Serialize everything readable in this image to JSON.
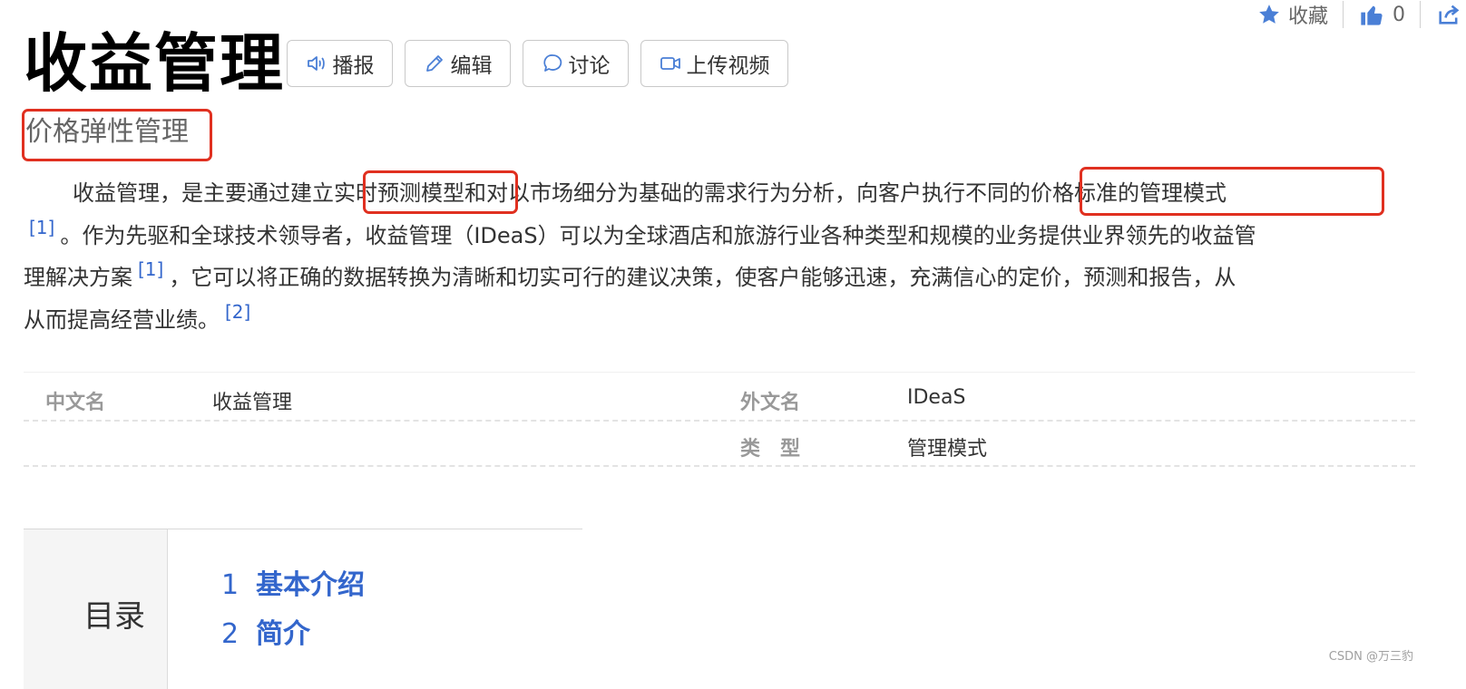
{
  "header": {
    "favorite_label": "收藏",
    "like_count": "0"
  },
  "title": "收益管理",
  "buttons": {
    "broadcast": "播报",
    "edit": "编辑",
    "discuss": "讨论",
    "upload_video": "上传视频"
  },
  "subtitle": "价格弹性管理",
  "paragraph": {
    "l1a": "收益管理，是主要通过建立",
    "l1b": "实时预测模型",
    "l1c": "和对以市场细分为基础的需求行为分析，向客户执行",
    "l1d": "不同的价格标准的管理模式",
    "ref1": "[1]",
    "l2": "。作为先驱和全球技术领导者，收益管理（IDeaS）可以为全球酒店和旅游行业各种类型和规模的业务提供业界领先的收益管",
    "l3a": "理解决方案",
    "ref2": "[1]",
    "l3b": "，它可以将正确的数据转换为清晰和切实可行的建议决策，使客户能够迅速，充满信心的定价，预测和报告，从",
    "l4": "从而提高经营业绩。",
    "ref3": "[2]"
  },
  "info": {
    "chinese_name_label": "中文名",
    "chinese_name_value": "收益管理",
    "foreign_name_label": "外文名",
    "foreign_name_value": "IDeaS",
    "type_label": "类　型",
    "type_value": "管理模式"
  },
  "toc": {
    "label": "目录",
    "items": [
      {
        "num": "1",
        "text": "基本介绍"
      },
      {
        "num": "2",
        "text": "简介"
      }
    ]
  },
  "watermark": "CSDN @万三豹",
  "colors": {
    "link": "#3366cc",
    "highlight_box": "#e03020",
    "icon_blue": "#4a7fd6"
  }
}
